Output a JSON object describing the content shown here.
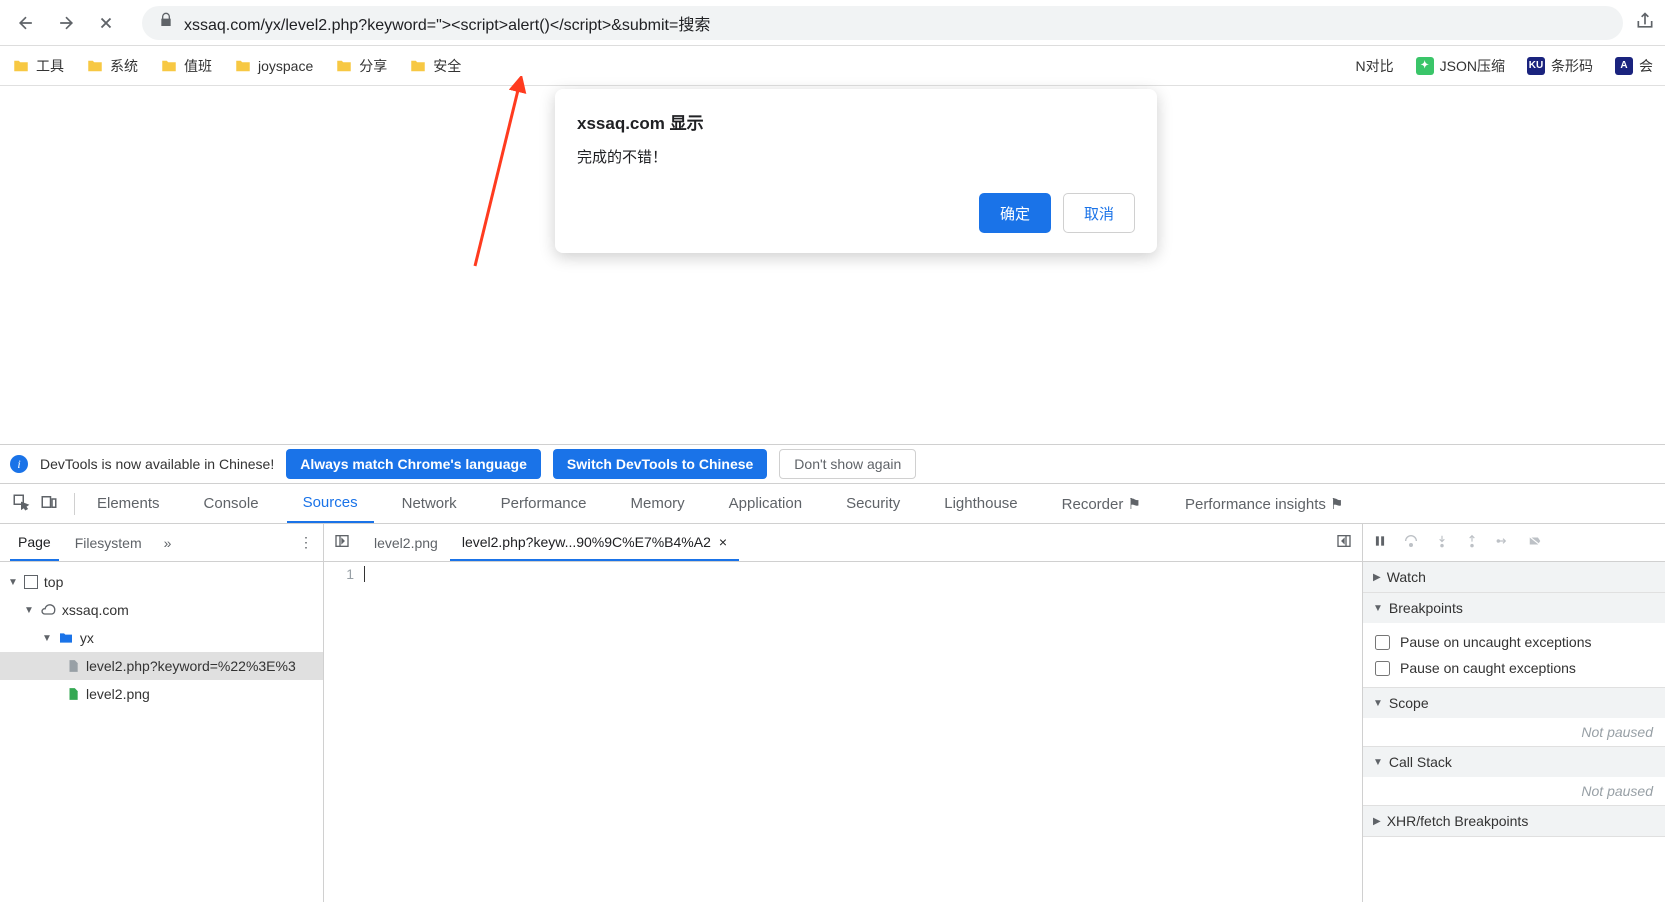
{
  "browser": {
    "url": "xssaq.com/yx/level2.php?keyword=\"><script>alert()</script>&submit=搜索"
  },
  "bookmarks": {
    "left": [
      "工具",
      "系统",
      "值班",
      "joyspace",
      "分享",
      "安全"
    ],
    "right": [
      {
        "label": "N对比",
        "badge": null
      },
      {
        "label": "JSON压缩",
        "badge": "#3ac569",
        "badgeText": "✦"
      },
      {
        "label": "条形码",
        "badge": "#1a237e",
        "badgeText": "KU"
      },
      {
        "label": "会",
        "badge": "#1a237e",
        "badgeText": "A"
      }
    ]
  },
  "alert": {
    "title": "xssaq.com 显示",
    "body": "完成的不错！",
    "ok": "确定",
    "cancel": "取消"
  },
  "notice": {
    "text": "DevTools is now available in Chinese!",
    "btn1": "Always match Chrome's language",
    "btn2": "Switch DevTools to Chinese",
    "btn3": "Don't show again"
  },
  "devtoolsTabs": [
    "Elements",
    "Console",
    "Sources",
    "Network",
    "Performance",
    "Memory",
    "Application",
    "Security",
    "Lighthouse",
    "Recorder ⚑",
    "Performance insights ⚑"
  ],
  "sidebarTabs": {
    "page": "Page",
    "fs": "Filesystem"
  },
  "tree": {
    "top": "top",
    "domain": "xssaq.com",
    "dir": "yx",
    "file1": "level2.php?keyword=%22%3E%3",
    "file2": "level2.png"
  },
  "editorTabs": {
    "t1": "level2.png",
    "t2": "level2.php?keyw...90%9C%E7%B4%A2"
  },
  "lineNo": "1",
  "dbg": {
    "watch": "Watch",
    "breakpoints": "Breakpoints",
    "uncaught": "Pause on uncaught exceptions",
    "caught": "Pause on caught exceptions",
    "scope": "Scope",
    "notPaused": "Not paused",
    "callstack": "Call Stack",
    "xhr": "XHR/fetch Breakpoints"
  }
}
